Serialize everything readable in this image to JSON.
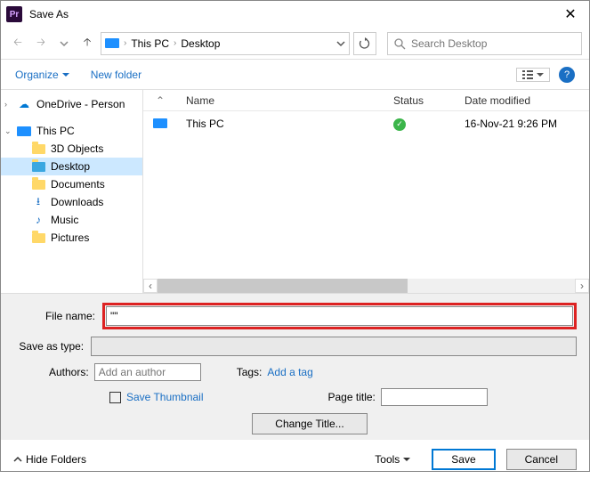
{
  "title": "Save As",
  "breadcrumb": {
    "loc1": "This PC",
    "loc2": "Desktop"
  },
  "search": {
    "placeholder": "Search Desktop"
  },
  "toolbar": {
    "organize": "Organize",
    "newfolder": "New folder"
  },
  "tree": {
    "onedrive": "OneDrive - Person",
    "thispc": "This PC",
    "objects3d": "3D Objects",
    "desktop": "Desktop",
    "documents": "Documents",
    "downloads": "Downloads",
    "music": "Music",
    "pictures": "Pictures"
  },
  "columns": {
    "name": "Name",
    "status": "Status",
    "date": "Date modified"
  },
  "row": {
    "name": "This PC",
    "date": "16-Nov-21 9:26 PM"
  },
  "form": {
    "filename_label": "File name:",
    "filename_value": "\"\"",
    "type_label": "Save as type:",
    "authors_label": "Authors:",
    "authors_ph": "Add an author",
    "tags_label": "Tags:",
    "tags_link": "Add a tag",
    "save_thumb": "Save Thumbnail",
    "pagetitle_label": "Page title:",
    "change_title": "Change Title..."
  },
  "footer": {
    "hide": "Hide Folders",
    "tools": "Tools",
    "save": "Save",
    "cancel": "Cancel"
  }
}
